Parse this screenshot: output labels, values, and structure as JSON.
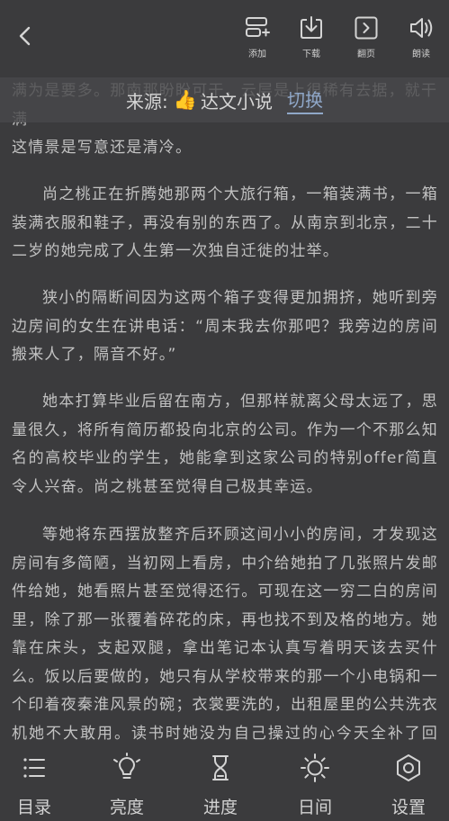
{
  "toolbar": {
    "add_label": "添加",
    "download_label": "下载",
    "page_label": "翻页",
    "read_aloud_label": "朗读"
  },
  "source": {
    "prefix": "来源:",
    "thumb_icon": "thumbs-up-icon",
    "name": "达文小说",
    "switch_label": "切换"
  },
  "content": {
    "partial_top": "满为是要多。那南那盼盼可干，云层是上很稀有去据，就干满",
    "p0_end": "这情景是写意还是清冷。",
    "p1": "尚之桃正在折腾她那两个大旅行箱，一箱装满书，一箱装满衣服和鞋子，再没有别的东西了。从南京到北京，二十二岁的她完成了人生第一次独自迁徙的壮举。",
    "p2": "狭小的隔断间因为这两个箱子变得更加拥挤，她听到旁边房间的女生在讲电话：“周末我去你那吧？我旁边的房间搬来人了，隔音不好。”",
    "p3": "她本打算毕业后留在南方，但那样就离父母太远了，思量很久，将所有简历都投向北京的公司。作为一个不那么知名的高校毕业的学生，她能拿到这家公司的特别offer简直令人兴奋。尚之桃甚至觉得自己极其幸运。",
    "p4": "等她将东西摆放整齐后环顾这间小小的房间，才发现这房间有多简陋，当初网上看房，中介给她拍了几张照片发邮件给她，她看照片甚至觉得还行。可现在这一穷二白的房间里，除了那一张覆着碎花的床，再也找不到及格的地方。她靠在床头，支起双腿，拿出笔记本认真写着明天该去买什么。饭以后要做的，她只有从学校带来的那一个小电锅和一个印着夜秦淮风景的碗；衣裳要洗的，出租屋里的公共洗衣机她不大敢用。读书时她没为自己操过的心今天全补了回来。这一操心，才发"
  },
  "bottom_nav": {
    "toc_label": "目录",
    "brightness_label": "亮度",
    "progress_label": "进度",
    "day_label": "日间",
    "settings_label": "设置"
  },
  "colors": {
    "background": "#3b3b3d",
    "text": "#c2c2c2",
    "accent_link": "#8fa7c8"
  }
}
